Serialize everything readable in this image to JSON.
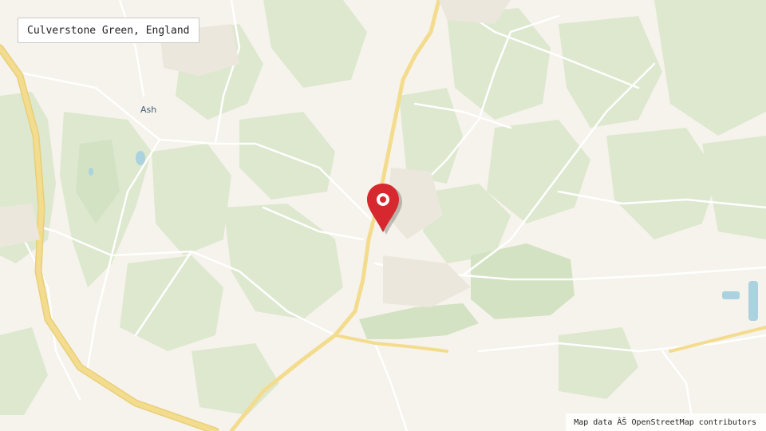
{
  "map": {
    "title": "Culverstone Green, England",
    "place_labels": {
      "ash": "Ash"
    },
    "attribution": "Map data ÂŠ OpenStreetMap contributors",
    "marker": {
      "icon": "map-pin-icon",
      "color": "#d7282f"
    },
    "colors": {
      "background": "#f6f3ec",
      "woodland": "#dde8cf",
      "woodland_dark": "#d3e2c2",
      "major_road": "#f4dc8e",
      "minor_road": "#ffffff",
      "water": "#aad3df"
    }
  }
}
